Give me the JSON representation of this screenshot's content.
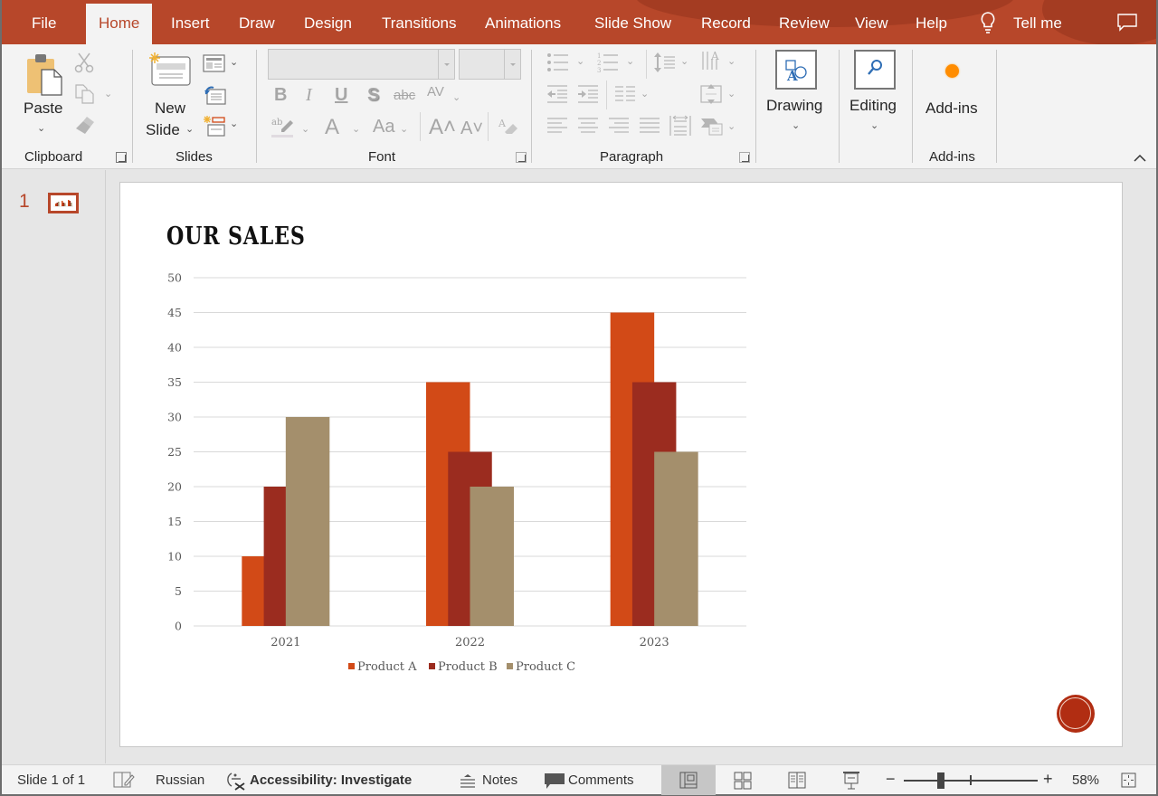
{
  "tabs": [
    {
      "label": "File",
      "active": false
    },
    {
      "label": "Home",
      "active": true
    },
    {
      "label": "Insert",
      "active": false
    },
    {
      "label": "Draw",
      "active": false
    },
    {
      "label": "Design",
      "active": false
    },
    {
      "label": "Transitions",
      "active": false
    },
    {
      "label": "Animations",
      "active": false
    },
    {
      "label": "Slide Show",
      "active": false
    },
    {
      "label": "Record",
      "active": false
    },
    {
      "label": "Review",
      "active": false
    },
    {
      "label": "View",
      "active": false
    },
    {
      "label": "Help",
      "active": false
    }
  ],
  "tell_me": "Tell me",
  "ribbon": {
    "clipboard": {
      "label": "Clipboard",
      "paste": "Paste"
    },
    "slides": {
      "label": "Slides",
      "new_slide_line1": "New",
      "new_slide_line2": "Slide"
    },
    "font": {
      "label": "Font",
      "font_name": "",
      "font_size": ""
    },
    "paragraph": {
      "label": "Paragraph"
    },
    "drawing": {
      "label": "Drawing"
    },
    "editing": {
      "label": "Editing"
    },
    "addins": {
      "button": "Add-ins",
      "label": "Add-ins"
    }
  },
  "thumbnails": [
    {
      "number": "1"
    }
  ],
  "slide": {
    "title": "OUR SALES"
  },
  "chart_data": {
    "type": "bar",
    "title": "",
    "xlabel": "",
    "ylabel": "",
    "categories": [
      "2021",
      "2022",
      "2023"
    ],
    "series": [
      {
        "name": "Product A",
        "color": "#d24a17",
        "values": [
          10,
          35,
          45
        ]
      },
      {
        "name": "Product B",
        "color": "#9b2c1f",
        "values": [
          20,
          25,
          35
        ]
      },
      {
        "name": "Product C",
        "color": "#a48f6c",
        "values": [
          30,
          20,
          25
        ]
      }
    ],
    "ylim": [
      0,
      50
    ],
    "yticks": [
      0,
      5,
      10,
      15,
      20,
      25,
      30,
      35,
      40,
      45,
      50
    ],
    "grid": true,
    "legend": "bottom"
  },
  "status": {
    "slide_info": "Slide 1 of 1",
    "language": "Russian",
    "accessibility": "Accessibility: Investigate",
    "notes": "Notes",
    "comments": "Comments",
    "zoom": "58%"
  },
  "colors": {
    "accent": "#b7472a"
  }
}
